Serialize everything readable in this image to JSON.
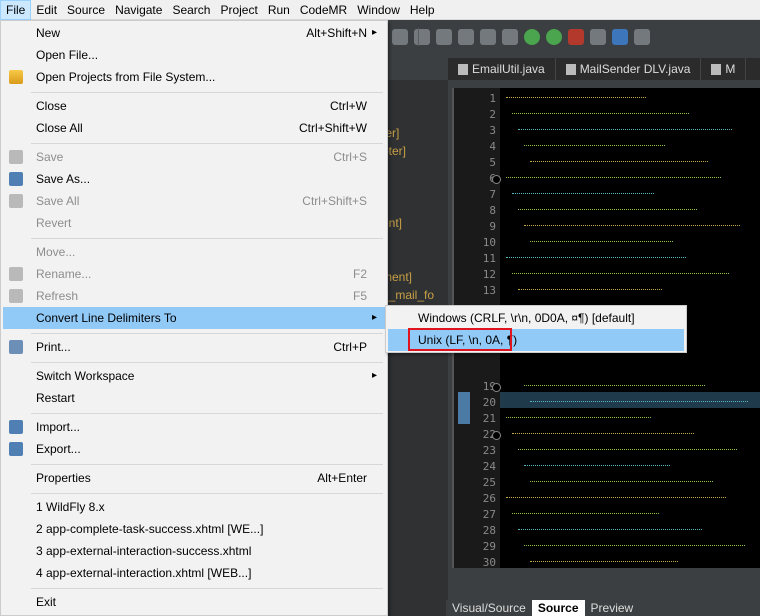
{
  "menubar": [
    "File",
    "Edit",
    "Source",
    "Navigate",
    "Search",
    "Project",
    "Run",
    "CodeMR",
    "Window",
    "Help"
  ],
  "tabs": [
    "EmailUtil.java",
    "MailSender DLV.java",
    "M"
  ],
  "file_menu": {
    "new": {
      "label": "New",
      "accel": "Alt+Shift+N"
    },
    "open_file": {
      "label": "Open File..."
    },
    "open_projects": {
      "label": "Open Projects from File System..."
    },
    "close": {
      "label": "Close",
      "accel": "Ctrl+W"
    },
    "close_all": {
      "label": "Close All",
      "accel": "Ctrl+Shift+W"
    },
    "save": {
      "label": "Save",
      "accel": "Ctrl+S"
    },
    "save_as": {
      "label": "Save As..."
    },
    "save_all": {
      "label": "Save All",
      "accel": "Ctrl+Shift+S"
    },
    "revert": {
      "label": "Revert"
    },
    "move": {
      "label": "Move..."
    },
    "rename": {
      "label": "Rename...",
      "accel": "F2"
    },
    "refresh": {
      "label": "Refresh",
      "accel": "F5"
    },
    "convert": {
      "label": "Convert Line Delimiters To"
    },
    "print": {
      "label": "Print...",
      "accel": "Ctrl+P"
    },
    "switch_workspace": {
      "label": "Switch Workspace"
    },
    "restart": {
      "label": "Restart"
    },
    "import": {
      "label": "Import..."
    },
    "export": {
      "label": "Export..."
    },
    "properties": {
      "label": "Properties",
      "accel": "Alt+Enter"
    },
    "recent": [
      "1 WildFly  8.x",
      "2 app-complete-task-success.xhtml  [WE...]",
      "3 app-external-interaction-success.xhtml",
      "4 app-external-interaction.xhtml  [WEB...]"
    ],
    "exit": {
      "label": "Exit"
    }
  },
  "submenu": {
    "windows": "Windows (CRLF, \\r\\n, 0D0A, ¤¶) [default]",
    "unix": "Unix (LF, \\n, 0A, ¶)"
  },
  "line_numbers": [
    "1",
    "2",
    "3",
    "4",
    "5",
    "6",
    "7",
    "8",
    "9",
    "10",
    "11",
    "12",
    "13",
    "19",
    "20",
    "21",
    "22",
    "23",
    "24",
    "25",
    "26",
    "27",
    "28",
    "29",
    "30"
  ],
  "left_fragments": [
    "ter]",
    "oter]",
    "ent]",
    "ment]",
    "e_mail_fo"
  ],
  "bottom_tabs": [
    "Visual/Source",
    "Source",
    "Preview"
  ]
}
